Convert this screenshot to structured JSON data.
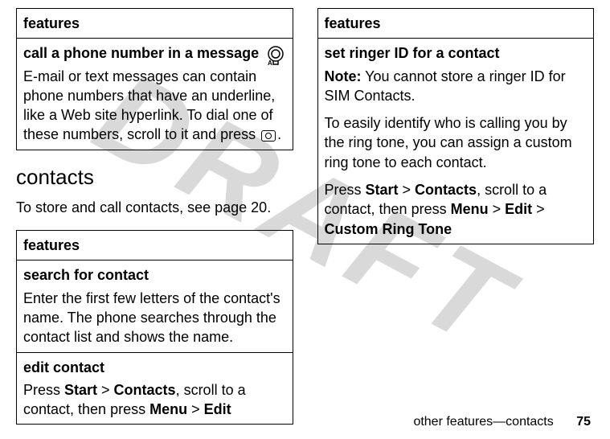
{
  "watermark": "DRAFT",
  "left": {
    "box1": {
      "header": "features",
      "row1_title": "call a phone number in a message",
      "row1_body_a": "E-mail or text messages can contain phone numbers that have an underline, like a Web site hyperlink. To dial one of these numbers, scroll to it and press ",
      "row1_body_b": "."
    },
    "section_title": "contacts",
    "section_body": "To store and call contacts, see page 20.",
    "box2": {
      "header": "features",
      "row1_title": "search for contact",
      "row1_body": "Enter the first few letters of the contact's name. The phone searches through the contact list and shows the name.",
      "row2_title": "edit contact",
      "row2_a": "Press ",
      "row2_start": "Start",
      "row2_gt1": " > ",
      "row2_contacts": "Contacts",
      "row2_b": ", scroll to a contact, then press ",
      "row2_menu": "Menu",
      "row2_gt2": " > ",
      "row2_edit": "Edit"
    }
  },
  "right": {
    "box1": {
      "header": "features",
      "row1_title": "set ringer ID for a contact",
      "note_label": "Note:",
      "note_body": " You cannot store a ringer ID for SIM Contacts.",
      "p2": "To easily identify who is calling you by the ring tone, you can assign a custom ring tone to each contact.",
      "p3_a": "Press ",
      "p3_start": "Start",
      "p3_gt1": " > ",
      "p3_contacts": "Contacts",
      "p3_b": ", scroll to a contact, then press ",
      "p3_menu": "Menu",
      "p3_gt2": " > ",
      "p3_edit": "Edit",
      "p3_gt3": " > ",
      "p3_crt": "Custom Ring Tone"
    }
  },
  "footer": {
    "breadcrumb": "other features—contacts",
    "page": "75"
  }
}
